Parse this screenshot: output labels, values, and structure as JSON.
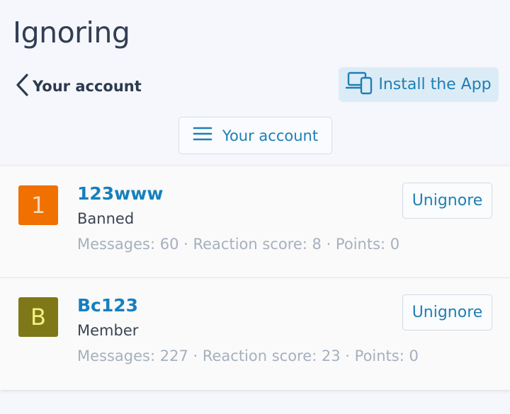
{
  "page": {
    "title": "Ignoring"
  },
  "nav": {
    "back_label": "Your account",
    "install_label": "Install the App",
    "menu_label": "Your account"
  },
  "colors": {
    "accent": "#1e7fb5",
    "username": "#1680bd",
    "muted": "#a6b0be"
  },
  "users": [
    {
      "initial": "1",
      "avatar_bg": "#f07000",
      "avatar_fg": "#f8d9b5",
      "name": "123www",
      "role": "Banned",
      "stats": "Messages: 60 · Reaction score: 8 · Points: 0",
      "action": "Unignore"
    },
    {
      "initial": "B",
      "avatar_bg": "#7f7818",
      "avatar_fg": "#f3f080",
      "name": "Bc123",
      "role": "Member",
      "stats": "Messages: 227 · Reaction score: 23 · Points: 0",
      "action": "Unignore"
    }
  ],
  "icons": {
    "back": "chevron-left-icon",
    "install": "devices-icon",
    "menu": "hamburger-icon"
  }
}
